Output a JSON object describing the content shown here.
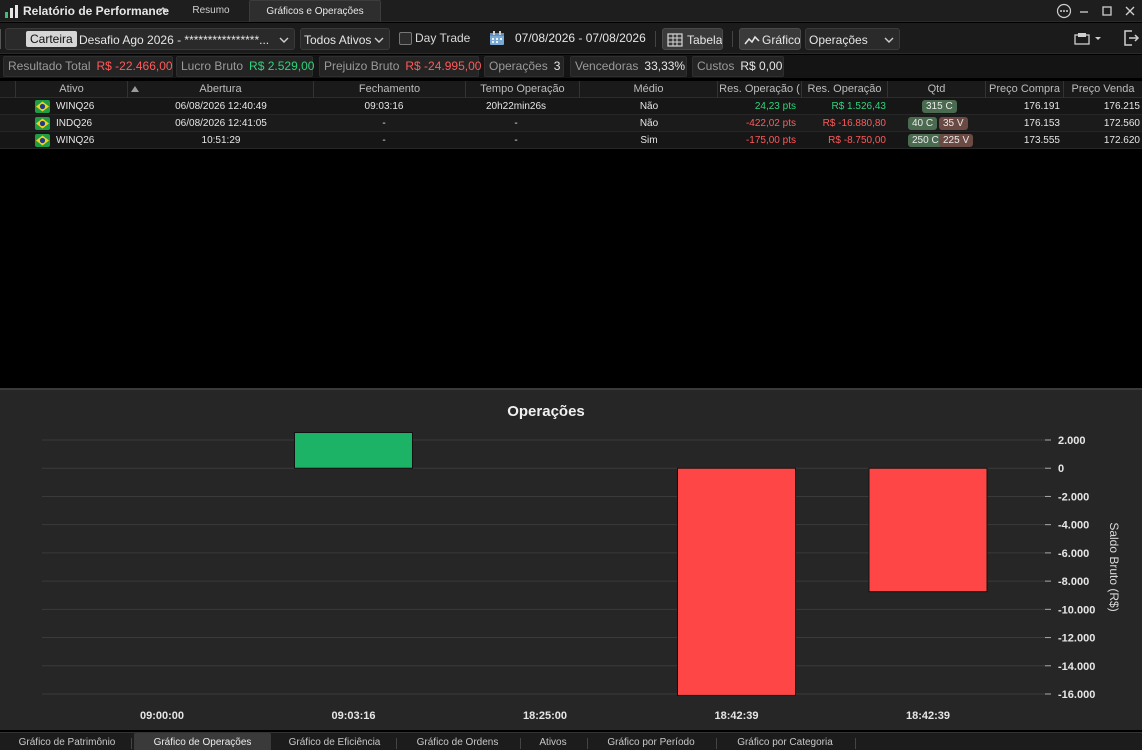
{
  "window": {
    "title": "Relatório de Performance",
    "tabs": [
      {
        "label": "Resumo",
        "active": false
      },
      {
        "label": "Gráficos e Operações",
        "active": true
      }
    ]
  },
  "toolbar": {
    "carteira_label": "Carteira",
    "carteira_value": "Desafio Ago 2026 - ****************...",
    "ativos_value": "Todos Ativos",
    "daytrade_label": "Day Trade",
    "daytrade_checked": false,
    "date_range": "07/08/2026 - 07/08/2026",
    "tabela_label": "Tabela",
    "grafico_label": "Gráfico",
    "operacoes_value": "Operações"
  },
  "stats": {
    "resultado_total": {
      "label": "Resultado Total",
      "value": "R$ -22.466,00"
    },
    "lucro_bruto": {
      "label": "Lucro Bruto",
      "value": "R$ 2.529,00"
    },
    "prejuizo_bruto": {
      "label": "Prejuizo Bruto",
      "value": "R$ -24.995,00"
    },
    "operacoes": {
      "label": "Operações",
      "value": "3"
    },
    "vencedoras": {
      "label": "Vencedoras",
      "value": "33,33%"
    },
    "custos": {
      "label": "Custos",
      "value": "R$ 0,00"
    }
  },
  "table": {
    "columns": [
      "Ativo",
      "Abertura",
      "Fechamento",
      "Tempo Operação",
      "Médio",
      "Res. Operação (",
      "Res. Operação",
      "Qtd",
      "Preço Compra",
      "Preço Venda"
    ],
    "rows": [
      {
        "ativo": "WINQ26",
        "abertura": "06/08/2026 12:40:49",
        "fechamento": "09:03:16",
        "tempo": "20h22min26s",
        "medio": "Não",
        "res_pts": "24,23 pts",
        "res_rs": "R$ 1.526,43",
        "qtd_c": "315 C",
        "qtd_v": "",
        "preco_compra": "176.191",
        "preco_venda": "176.215",
        "positive": true
      },
      {
        "ativo": "INDQ26",
        "abertura": "06/08/2026 12:41:05",
        "fechamento": "-",
        "tempo": "-",
        "medio": "Não",
        "res_pts": "-422,02 pts",
        "res_rs": "R$ -16.880,80",
        "qtd_c": "40 C",
        "qtd_v": "35 V",
        "preco_compra": "176.153",
        "preco_venda": "172.560",
        "positive": false
      },
      {
        "ativo": "WINQ26",
        "abertura": "10:51:29",
        "fechamento": "-",
        "tempo": "-",
        "medio": "Sim",
        "res_pts": "-175,00 pts",
        "res_rs": "R$ -8.750,00",
        "qtd_c": "250 C",
        "qtd_v": "225 V",
        "preco_compra": "173.555",
        "preco_venda": "172.620",
        "positive": false
      }
    ]
  },
  "chart_data": {
    "type": "bar",
    "title": "Operações",
    "ylabel": "Saldo Bruto (R$)",
    "xlabel": "",
    "categories": [
      "09:00:00",
      "09:03:16",
      "18:25:00",
      "18:42:39",
      "18:42:39"
    ],
    "values": [
      null,
      2529,
      null,
      -16100,
      -8750
    ],
    "ylim": [
      -16000,
      2000
    ],
    "yticks": [
      2000,
      0,
      -2000,
      -4000,
      -6000,
      -8000,
      -10000,
      -12000,
      -14000,
      -16000
    ],
    "ytick_labels": [
      "2.000",
      "0",
      "-2.000",
      "-4.000",
      "-6.000",
      "-8.000",
      "-10.000",
      "-12.000",
      "-14.000",
      "-16.000"
    ],
    "grid": true,
    "positive_color": "#1db366",
    "negative_color": "#ff4646"
  },
  "bottom_tabs": [
    {
      "label": "Gráfico de Patrimônio",
      "active": false
    },
    {
      "label": "Gráfico de Operações",
      "active": true
    },
    {
      "label": "Gráfico de Eficiência",
      "active": false
    },
    {
      "label": "Gráfico de Ordens",
      "active": false
    },
    {
      "label": "Ativos",
      "active": false
    },
    {
      "label": "Gráfico por Período",
      "active": false
    },
    {
      "label": "Gráfico por Categoria",
      "active": false
    }
  ],
  "icons": [
    "app-chart-icon",
    "chevron-up-icon",
    "more-icon",
    "minimize-icon",
    "maximize-icon",
    "close-icon",
    "calendar-icon",
    "table-icon",
    "line-chart-icon",
    "print-icon",
    "exit-icon",
    "brazil-flag-icon"
  ]
}
